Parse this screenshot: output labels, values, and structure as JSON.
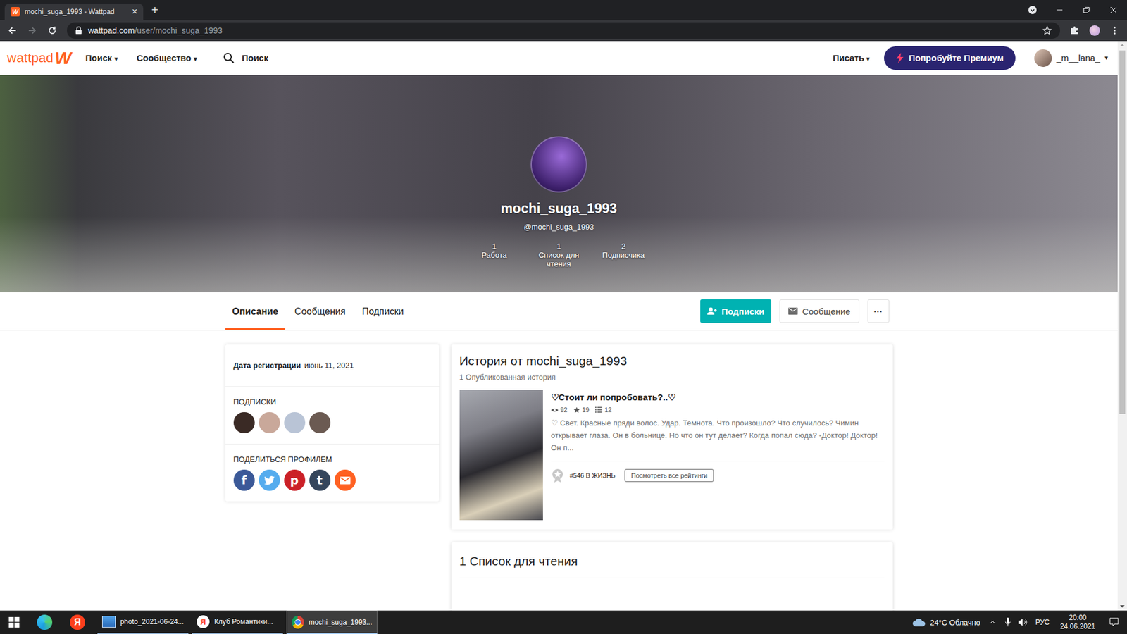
{
  "browser": {
    "tab_title": "mochi_suga_1993 - Wattpad",
    "tab_close": "×",
    "new_tab": "+",
    "url_host": "wattpad.com",
    "url_path": "/user/mochi_suga_1993",
    "back_enabled": true,
    "forward_enabled": false,
    "bookmarked": false
  },
  "nav": {
    "logo": "wattpad",
    "logo_mark": "W",
    "caret": "▾",
    "menus": [
      {
        "label": "Поиск"
      },
      {
        "label": "Сообщество"
      }
    ],
    "search_placeholder": "Поиск",
    "write": "Писать",
    "premium": "Попробуйте Премиум",
    "username": "_m__lana_"
  },
  "profile": {
    "name": "mochi_suga_1993",
    "handle": "@mochi_suga_1993",
    "stats": [
      {
        "value": "1",
        "label": "Работа"
      },
      {
        "value": "1",
        "label": "Список для чтения"
      },
      {
        "value": "2",
        "label": "Подписчика"
      }
    ]
  },
  "tabs": [
    {
      "label": "Описание",
      "selected": true
    },
    {
      "label": "Сообщения",
      "selected": false
    },
    {
      "label": "Подписки",
      "selected": false
    }
  ],
  "actions": {
    "follow": "Подписки",
    "message": "Сообщение",
    "more": "···"
  },
  "about": {
    "joined_label": "Дата регистрации",
    "joined_value": "июнь 11, 2021",
    "following_title": "ПОДПИСКИ",
    "following": [
      {
        "color": "#3a2a25"
      },
      {
        "color": "#c9a89a"
      },
      {
        "color": "#b9c4d6"
      },
      {
        "color": "#6b5a52"
      }
    ],
    "share_title": "ПОДЕЛИТЬСЯ ПРОФИЛЕМ",
    "share": [
      {
        "kind": "facebook",
        "glyph": "f",
        "color": "#3b5998"
      },
      {
        "kind": "twitter",
        "color": "#55acee"
      },
      {
        "kind": "pinterest",
        "glyph": "p",
        "color": "#cb2027"
      },
      {
        "kind": "tumblr",
        "glyph": "t",
        "color": "#35465c"
      },
      {
        "kind": "email",
        "color": "#ff6122"
      }
    ]
  },
  "stories": {
    "title": "История от mochi_suga_1993",
    "count": "1 Опубликованная история",
    "items": [
      {
        "title": "♡Стоит ли попробовать?..♡",
        "reads": "92",
        "votes": "19",
        "parts": "12",
        "description": "♡ Свет. Красные пряди волос. Удар. Темнота. Что произошло? Что случилось? Чимин открывает глаза. Он в больнице. Но что он тут делает? Когда попал сюда? -Доктор! Доктор! Он п...",
        "rank": "#546 В ЖИЗНЬ",
        "rankings_button": "Посмотреть все рейтинги"
      }
    ]
  },
  "reading_lists": {
    "title": "1 Список для чтения"
  },
  "scrollbar": {
    "level": 0.66
  },
  "taskbar": {
    "pinned": [
      {
        "kind": "edge"
      },
      {
        "kind": "yandex",
        "glyph": "Я"
      }
    ],
    "apps": [
      {
        "kind": "photos",
        "label": "photo_2021-06-24...",
        "selected": false
      },
      {
        "kind": "yandex",
        "label": "Клуб Романтики...",
        "selected": false
      },
      {
        "kind": "chrome",
        "label": "mochi_suga_1993...",
        "selected": true
      }
    ],
    "weather": "24°C Облачно",
    "lang": "РУС",
    "time": "20:00",
    "date": "24.06.2021"
  }
}
